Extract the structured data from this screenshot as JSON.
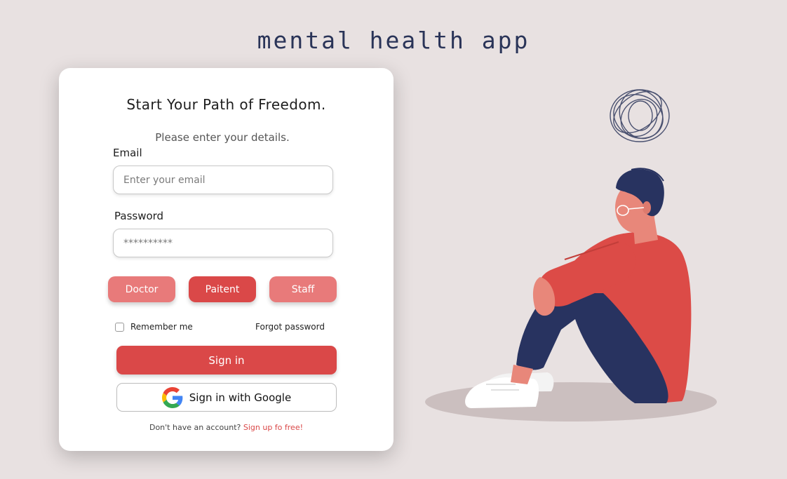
{
  "app": {
    "title": "mental health app"
  },
  "login": {
    "heading": "Start Your Path of Freedom.",
    "subheading": "Please enter your details.",
    "email": {
      "label": "Email",
      "placeholder": "Enter your email",
      "value": ""
    },
    "password": {
      "label": "Password",
      "placeholder": "**********",
      "value": ""
    },
    "roles": [
      {
        "label": "Doctor",
        "selected": false
      },
      {
        "label": "Paitent",
        "selected": true
      },
      {
        "label": "Staff",
        "selected": false
      }
    ],
    "remember_label": "Remember me",
    "remember_checked": false,
    "forgot_label": "Forgot password",
    "signin_label": "Sign in",
    "google_label": "Sign in with Google",
    "signup_prompt": "Don't have an account?",
    "signup_link": "Sign up fo free!"
  },
  "illustration": {
    "subject": "sad-person-sitting",
    "scribble": "worry-scribble-icon"
  },
  "colors": {
    "background": "#e8e1e1",
    "primary": "#da4848",
    "primary_light": "#e87a7a",
    "title": "#2a3458"
  }
}
